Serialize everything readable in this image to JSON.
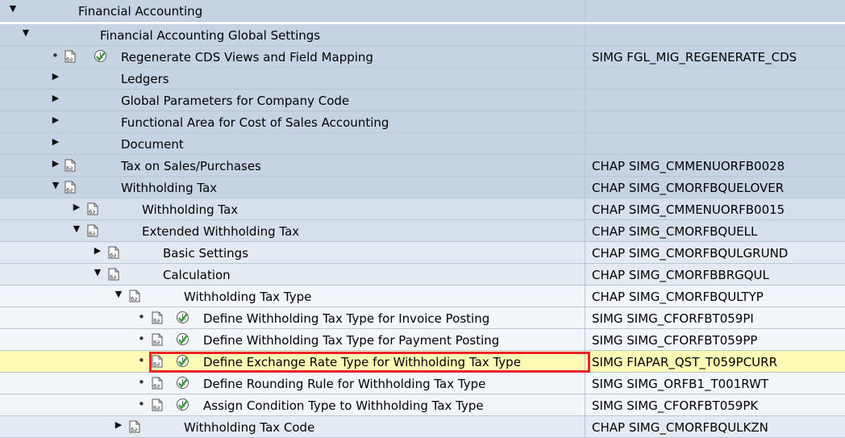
{
  "tree": {
    "rows": [
      {
        "label": "Financial Accounting",
        "tech": "",
        "state": "expanded"
      },
      {
        "label": "Financial Accounting Global Settings",
        "tech": "",
        "state": "expanded"
      },
      {
        "label": "Regenerate CDS Views and Field Mapping",
        "tech": "SIMG FGL_MIG_REGENERATE_CDS",
        "state": "leaf",
        "icons": [
          "document-icon",
          "execute-icon"
        ]
      },
      {
        "label": "Ledgers",
        "tech": "",
        "state": "collapsed"
      },
      {
        "label": "Global Parameters for Company Code",
        "tech": "",
        "state": "collapsed"
      },
      {
        "label": "Functional Area for Cost of Sales Accounting",
        "tech": "",
        "state": "collapsed"
      },
      {
        "label": "Document",
        "tech": "",
        "state": "collapsed"
      },
      {
        "label": "Tax on Sales/Purchases",
        "tech": "CHAP SIMG_CMMENUORFB0028",
        "state": "collapsed",
        "icons": [
          "document-icon"
        ]
      },
      {
        "label": "Withholding Tax",
        "tech": "CHAP SIMG_CMORFBQUELOVER",
        "state": "expanded",
        "icons": [
          "document-icon"
        ]
      },
      {
        "label": "Withholding Tax",
        "tech": "CHAP SIMG_CMMENUORFB0015",
        "state": "collapsed",
        "icons": [
          "document-icon"
        ]
      },
      {
        "label": "Extended Withholding Tax",
        "tech": "CHAP SIMG_CMORFBQUELL",
        "state": "expanded",
        "icons": [
          "document-icon"
        ]
      },
      {
        "label": "Basic Settings",
        "tech": "CHAP SIMG_CMORFBQULGRUND",
        "state": "collapsed",
        "icons": [
          "document-icon"
        ]
      },
      {
        "label": "Calculation",
        "tech": "CHAP SIMG_CMORFBBRGQUL",
        "state": "expanded",
        "icons": [
          "document-icon"
        ]
      },
      {
        "label": "Withholding Tax Type",
        "tech": "CHAP SIMG_CMORFBQULTYP",
        "state": "expanded",
        "icons": [
          "document-icon"
        ]
      },
      {
        "label": "Define Withholding Tax Type for Invoice Posting",
        "tech": "SIMG SIMG_CFORFBT059PI",
        "state": "leaf",
        "icons": [
          "document-icon",
          "execute-icon"
        ]
      },
      {
        "label": "Define Withholding Tax Type for Payment Posting",
        "tech": "SIMG SIMG_CFORFBT059PP",
        "state": "leaf",
        "icons": [
          "document-icon",
          "execute-icon"
        ]
      },
      {
        "label": "Define Exchange Rate Type for Withholding Tax Type",
        "tech": "SIMG FIAPAR_QST_T059PCURR",
        "state": "leaf",
        "icons": [
          "document-icon",
          "execute-icon"
        ],
        "selected": true
      },
      {
        "label": "Define Rounding Rule for Withholding Tax Type",
        "tech": "SIMG SIMG_ORFB1_T001RWT",
        "state": "leaf",
        "icons": [
          "document-icon",
          "execute-icon"
        ]
      },
      {
        "label": "Assign Condition Type to Withholding Tax Type",
        "tech": "SIMG SIMG_CFORFBT059PK",
        "state": "leaf",
        "icons": [
          "document-icon",
          "execute-icon"
        ]
      },
      {
        "label": "Withholding Tax Code",
        "tech": "CHAP SIMG_CMORFBQULKZN",
        "state": "collapsed",
        "icons": [
          "document-icon"
        ]
      }
    ]
  },
  "colors": {
    "highlight_border": "#e8252a",
    "selected_row": "#fbfbb6",
    "execute_icon": "#3a9a3a"
  }
}
